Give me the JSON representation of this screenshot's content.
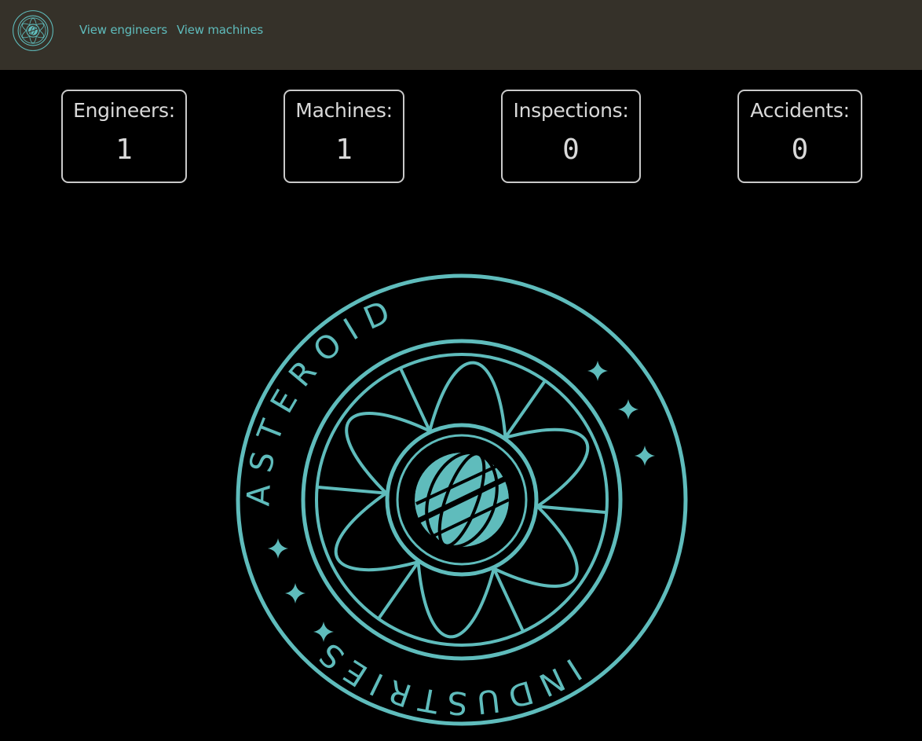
{
  "nav": {
    "logo_text": "ASTEROID INDUSTRIES",
    "links": [
      {
        "label": "View engineers"
      },
      {
        "label": "View machines"
      }
    ]
  },
  "stats": [
    {
      "label": "Engineers:",
      "value": "1"
    },
    {
      "label": "Machines:",
      "value": "1"
    },
    {
      "label": "Inspections:",
      "value": "0"
    },
    {
      "label": "Accidents:",
      "value": "0"
    }
  ],
  "emblem": {
    "top_text": "INDUSTRIES",
    "bottom_text": "ASTEROID",
    "color": "#5fbcbc"
  },
  "colors": {
    "navbar_bg": "#353129",
    "page_bg": "#000000",
    "accent": "#5fbcbc",
    "card_border": "#c9c9c9"
  }
}
